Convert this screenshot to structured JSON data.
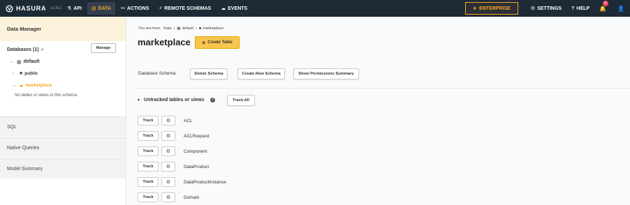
{
  "nav": {
    "brand": "HASURA",
    "version": "v2.36.1",
    "items": [
      {
        "label": "API",
        "icon": "flask-icon"
      },
      {
        "label": "DATA",
        "icon": "database-icon"
      },
      {
        "label": "ACTIONS",
        "icon": "actions-icon"
      },
      {
        "label": "REMOTE SCHEMAS",
        "icon": "plug-icon"
      },
      {
        "label": "EVENTS",
        "icon": "cloud-icon"
      }
    ],
    "enterprise": "ENTERPRISE",
    "settings": "SETTINGS",
    "help": "HELP",
    "notification_count": "6"
  },
  "sidebar": {
    "header": "Data Manager",
    "databases_label": "Databases (1)",
    "manage_label": "Manage",
    "tree": {
      "db": "default",
      "schemas": [
        "public",
        "marketplace"
      ]
    },
    "empty_message": "No tables or views in this schema",
    "sections": [
      "SQL",
      "Native Queries",
      "Model Summary"
    ]
  },
  "main": {
    "breadcrumb": {
      "prefix": "You are here:",
      "data": "Data",
      "db": "default",
      "schema": "marketplace"
    },
    "title": "marketplace",
    "create_table_label": "Create Table",
    "schema_label": "Database Schema",
    "delete_schema_label": "Delete Schema",
    "create_schema_label": "Create New Schema",
    "permissions_label": "Show Permissions Summary",
    "untracked_label": "Untracked tables or views",
    "track_all_label": "Track All",
    "track_label": "Track",
    "tables": [
      "ACL",
      "ACLRequest",
      "Component",
      "DataProduct",
      "DataProductInstance",
      "Domain"
    ]
  },
  "colors": {
    "topbar": "#1f2a37",
    "accent": "#f5a623",
    "create_button": "#f8c64e",
    "sidebar_header": "#fdf3dd"
  }
}
